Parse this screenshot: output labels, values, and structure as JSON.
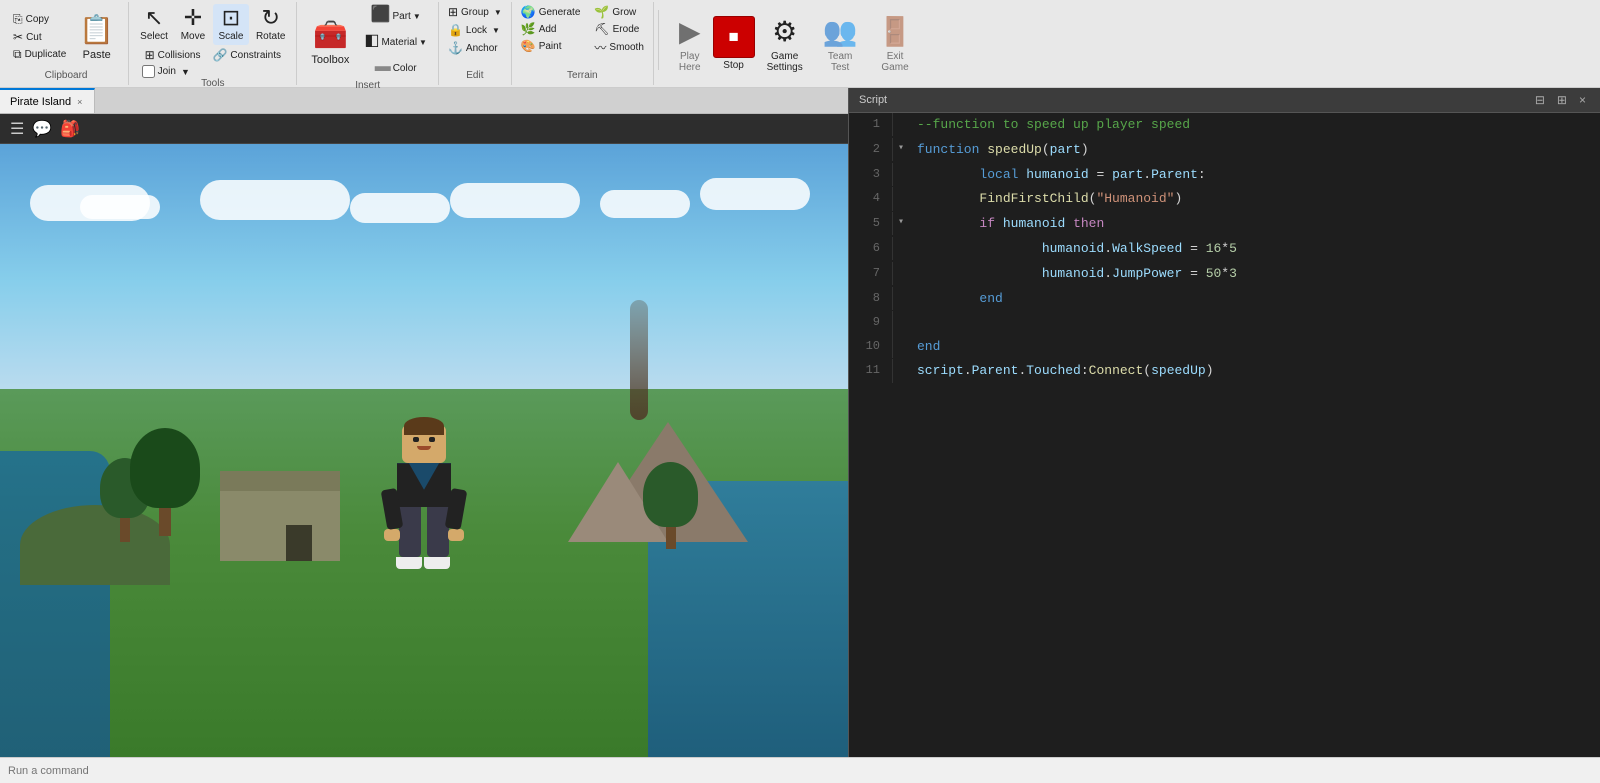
{
  "toolbar": {
    "clipboard_label": "Clipboard",
    "tools_label": "Tools",
    "insert_label": "Insert",
    "edit_label": "Edit",
    "terrain_label": "Terrain",
    "copy_label": "Copy",
    "paste_label": "Paste",
    "cut_label": "Cut",
    "duplicate_label": "Duplicate",
    "select_label": "Select",
    "move_label": "Move",
    "scale_label": "Scale",
    "rotate_label": "Rotate",
    "collisions_label": "Collisions",
    "constraints_label": "Constraints",
    "join_label": "Join",
    "toolbox_label": "Toolbox",
    "part_label": "Part",
    "material_label": "Material",
    "color_label": "Color",
    "group_label": "Group",
    "lock_label": "Lock",
    "anchor_label": "Anchor",
    "generate_label": "Generate",
    "grow_label": "Grow",
    "add_label": "Add",
    "erode_label": "Erode",
    "paint_label": "Paint",
    "smooth_label": "Smooth",
    "play_here_label": "Play\nHere",
    "stop_label": "Stop",
    "game_settings_label": "Game\nSettings",
    "team_test_label": "Team\nTest",
    "exit_game_label": "Exit\nGame"
  },
  "tab": {
    "name": "Pirate Island",
    "close_icon": "×"
  },
  "script_panel": {
    "title": "Script",
    "minimize_icon": "⊟",
    "maximize_icon": "⊞",
    "close_icon": "×",
    "lines": [
      {
        "num": 1,
        "indent": 0,
        "collapsed": false,
        "content": "--function to speed up player speed",
        "type": "comment"
      },
      {
        "num": 2,
        "indent": 0,
        "collapsed": true,
        "content": "function speedUp(part)",
        "type": "function_decl"
      },
      {
        "num": 3,
        "indent": 1,
        "collapsed": false,
        "content": "    local humanoid = part.Parent:",
        "type": "local_decl"
      },
      {
        "num": 4,
        "indent": 1,
        "collapsed": false,
        "content": "    FindFirstChild(\"Humanoid\")",
        "type": "method_call"
      },
      {
        "num": 5,
        "indent": 1,
        "collapsed": true,
        "content": "    if humanoid then",
        "type": "if_stmt"
      },
      {
        "num": 6,
        "indent": 2,
        "collapsed": false,
        "content": "        humanoid.WalkSpeed = 16*5",
        "type": "assignment"
      },
      {
        "num": 7,
        "indent": 2,
        "collapsed": false,
        "content": "        humanoid.JumpPower = 50*3",
        "type": "assignment"
      },
      {
        "num": 8,
        "indent": 1,
        "collapsed": false,
        "content": "    end",
        "type": "end_stmt"
      },
      {
        "num": 9,
        "indent": 0,
        "collapsed": false,
        "content": "",
        "type": "empty"
      },
      {
        "num": 10,
        "indent": 0,
        "collapsed": false,
        "content": "end",
        "type": "end_stmt"
      },
      {
        "num": 11,
        "indent": 0,
        "collapsed": false,
        "content": "script.Parent.Touched:Connect(speedUp)",
        "type": "connect"
      }
    ]
  },
  "bottom_bar": {
    "placeholder": "Run a command"
  }
}
